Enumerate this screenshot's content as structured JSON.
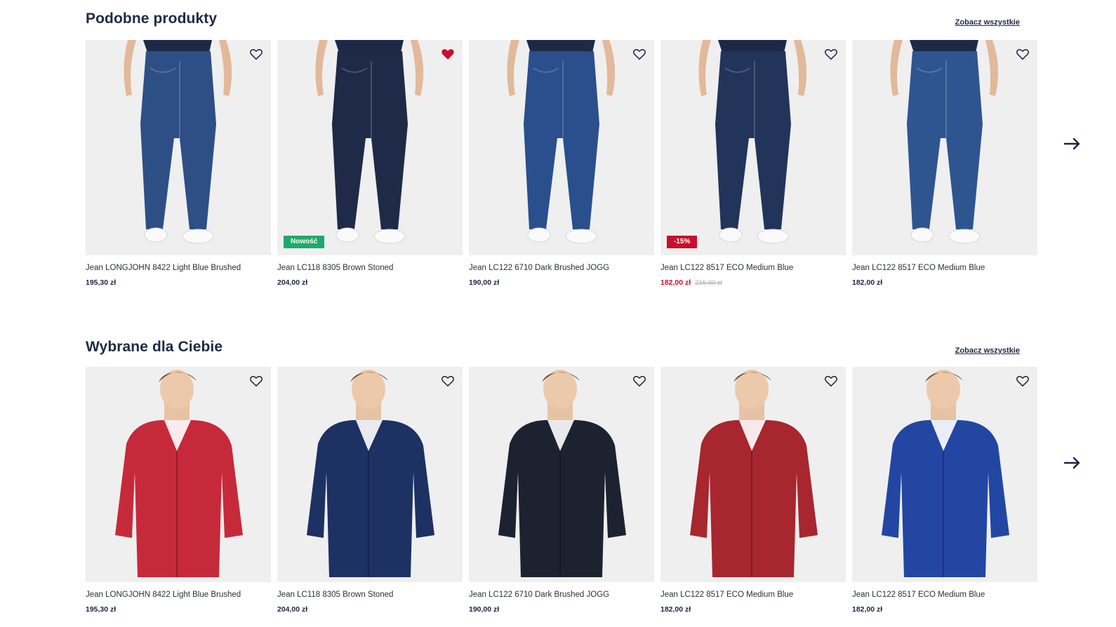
{
  "sections": [
    {
      "title": "Podobne produkty",
      "see_all": "Zobacz wszystkie",
      "products": [
        {
          "name": "Jean LONGJOHN 8422 Light Blue Brushed",
          "price": "195,30 zł",
          "badge": "",
          "old_price": "",
          "fav": false,
          "type": "jeans",
          "color": "#2d4f86"
        },
        {
          "name": "Jean LC118 8305 Brown Stoned",
          "price": "204,00 zł",
          "badge": "Nowość",
          "old_price": "",
          "fav": true,
          "type": "jeans",
          "color": "#1e2a48"
        },
        {
          "name": "Jean LC122 6710 Dark Brushed JOGG",
          "price": "190,00 zł",
          "badge": "",
          "old_price": "",
          "fav": false,
          "type": "jeans",
          "color": "#2a4f8c"
        },
        {
          "name": "Jean LC122 8517 ECO Medium Blue",
          "price": "182,00 zł",
          "badge": "-15%",
          "old_price": "215,00 zł",
          "fav": false,
          "type": "jeans",
          "color": "#22345a"
        },
        {
          "name": "Jean LC122 8517 ECO Medium Blue",
          "price": "182,00 zł",
          "badge": "",
          "old_price": "",
          "fav": false,
          "type": "jeans",
          "color": "#2e5590"
        }
      ]
    },
    {
      "title": "Wybrane dla Ciebie",
      "see_all": "Zobacz wszystkie",
      "products": [
        {
          "name": "Jean LONGJOHN 8422 Light Blue Brushed",
          "price": "195,30 zł",
          "badge": "",
          "old_price": "",
          "fav": false,
          "type": "top",
          "color": "#c62a3a"
        },
        {
          "name": "Jean LC118 8305 Brown Stoned",
          "price": "204,00 zł",
          "badge": "",
          "old_price": "",
          "fav": false,
          "type": "top",
          "color": "#1d3163"
        },
        {
          "name": "Jean LC122 6710 Dark Brushed JOGG",
          "price": "190,00 zł",
          "badge": "",
          "old_price": "",
          "fav": false,
          "type": "top",
          "color": "#1c2230"
        },
        {
          "name": "Jean LC122 8517 ECO Medium Blue",
          "price": "182,00 zł",
          "badge": "",
          "old_price": "",
          "fav": false,
          "type": "top",
          "color": "#a8262e"
        },
        {
          "name": "Jean LC122 8517 ECO Medium Blue",
          "price": "182,00 zł",
          "badge": "",
          "old_price": "",
          "fav": false,
          "type": "top",
          "color": "#2346a3"
        }
      ]
    }
  ],
  "icons": {
    "favorite": "heart-icon",
    "next": "arrow-right-icon"
  },
  "colors": {
    "sale": "#c8102e",
    "new": "#1eaa6c",
    "heading": "#1f2a44"
  }
}
